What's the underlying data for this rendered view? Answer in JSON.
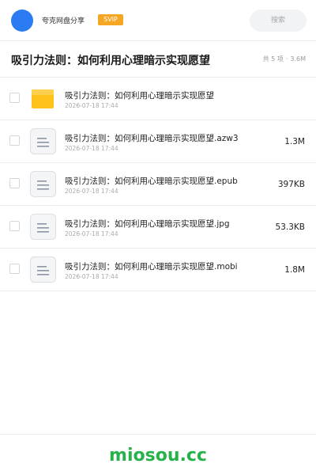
{
  "header": {
    "app_name": "夸克网盘分享",
    "badge": "SVIP",
    "search_placeholder": "搜索"
  },
  "share": {
    "title": "吸引力法则：如何利用心理暗示实现愿望",
    "count": "共 5 项",
    "separator": "·",
    "total_size": "3.6M"
  },
  "files": [
    {
      "type": "folder",
      "icon": "folder-icon",
      "name": "吸引力法则：如何利用心理暗示实现愿望",
      "date": "2026-07-18 17:44",
      "size": ""
    },
    {
      "type": "file",
      "icon": "document-icon",
      "name": "吸引力法则：如何利用心理暗示实现愿望.azw3",
      "date": "2026-07-18 17:44",
      "size": "1.3M"
    },
    {
      "type": "file",
      "icon": "document-icon",
      "name": "吸引力法则：如何利用心理暗示实现愿望.epub",
      "date": "2026-07-18 17:44",
      "size": "397KB"
    },
    {
      "type": "file",
      "icon": "document-icon",
      "name": "吸引力法则：如何利用心理暗示实现愿望.jpg",
      "date": "2026-07-18 17:44",
      "size": "53.3KB"
    },
    {
      "type": "file",
      "icon": "document-icon",
      "name": "吸引力法则：如何利用心理暗示实现愿望.mobi",
      "date": "2026-07-18 17:44",
      "size": "1.8M"
    }
  ],
  "footer": {
    "watermark": "miosou.cc"
  },
  "colors": {
    "avatar": "#2b7bf3",
    "badge": "#f5a623",
    "folder": "#ffc21a",
    "watermark": "#27b14a"
  }
}
